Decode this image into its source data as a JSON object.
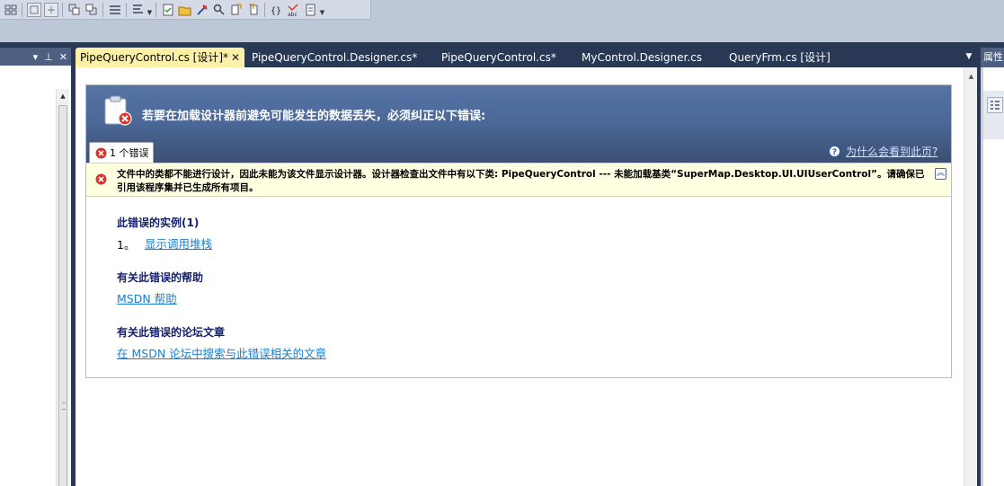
{
  "tabs": [
    {
      "label": "PipeQueryControl.cs [设计]*",
      "active": true
    },
    {
      "label": "PipeQueryControl.Designer.cs*",
      "active": false
    },
    {
      "label": "PipeQueryControl.cs*",
      "active": false
    },
    {
      "label": "MyControl.Designer.cs",
      "active": false
    },
    {
      "label": "QueryFrm.cs [设计]",
      "active": false
    }
  ],
  "tab_close_glyph": "✕",
  "left_panel": {
    "pin_glyph": "⊥",
    "close_glyph": "✕",
    "menu_glyph": "▾"
  },
  "right_panel": {
    "title": "属性"
  },
  "error_panel": {
    "title": "若要在加载设计器前避免可能发生的数据丢失，必须纠正以下错误:",
    "error_count_tab": "1 个错误",
    "help_link": "为什么会看到此页?",
    "message": "文件中的类都不能进行设计，因此未能为该文件显示设计器。设计器检查出文件中有以下类: PipeQueryControl --- 未能加载基类“SuperMap.Desktop.UI.UIUserControl”。请确保已引用该程序集并已生成所有项目。",
    "sections": [
      {
        "title": "此错误的实例(1)",
        "items": [
          {
            "num": "1。",
            "link": "显示调用堆栈"
          }
        ]
      },
      {
        "title": "有关此错误的帮助",
        "items": [
          {
            "link": "MSDN 帮助"
          }
        ]
      },
      {
        "title": "有关此错误的论坛文章",
        "items": [
          {
            "link": "在 MSDN 论坛中搜索与此错误相关的文章"
          }
        ]
      }
    ]
  },
  "colors": {
    "accent": "#fdf0a7",
    "chrome": "#293955",
    "link": "#1a7fd1",
    "error": "#d9352b"
  }
}
